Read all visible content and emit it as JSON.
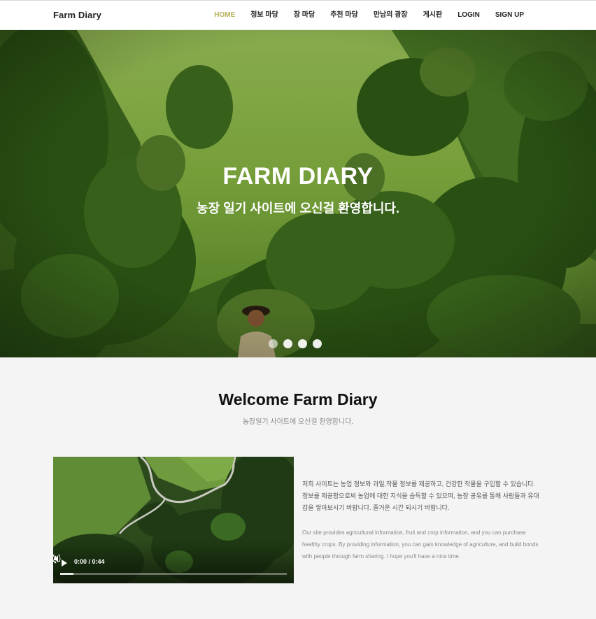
{
  "header": {
    "brand": "Farm Diary",
    "nav": [
      {
        "label": "HOME",
        "active": true
      },
      {
        "label": "정보 마당",
        "active": false
      },
      {
        "label": "장 마당",
        "active": false
      },
      {
        "label": "추천 마당",
        "active": false
      },
      {
        "label": "만남의 광장",
        "active": false
      },
      {
        "label": "게시판",
        "active": false
      },
      {
        "label": "LOGIN",
        "active": false
      },
      {
        "label": "SIGN UP",
        "active": false
      }
    ],
    "accent_color": "#b7b25a"
  },
  "hero": {
    "title": "FARM DIARY",
    "subtitle": "농장 일기 사이트에 오신걸 환영합니다.",
    "slides": 4,
    "active_slide": 1
  },
  "welcome": {
    "title": "Welcome Farm Diary",
    "subtitle": "농장일기 사이트에 오신걸 환영합니다."
  },
  "video": {
    "time": "0:00 / 0:44",
    "progress": 0.06,
    "icons": [
      "play-icon",
      "volume-icon",
      "fullscreen-icon",
      "more-options-icon"
    ]
  },
  "description": {
    "korean": "저희 사이트는 농업 정보와 과일,작물 정보를 제공하고, 건강한 작물을 구입할 수 있습니다. 정보를 제공함으로써 농업에 대한 지식을 습득할 수 있으며, 농장 공유를 통해 사람들과 유대감을 쌓아보시기 바랍니다. 즐거운 시간 되시기 바랍니다.",
    "english": "Our site provides agricultural information, fruit and crop information, and you can purchase healthy crops. By providing information, you can gain knowledge of agriculture, and build bonds with people through farm sharing. I hope you'll have a nice time."
  }
}
